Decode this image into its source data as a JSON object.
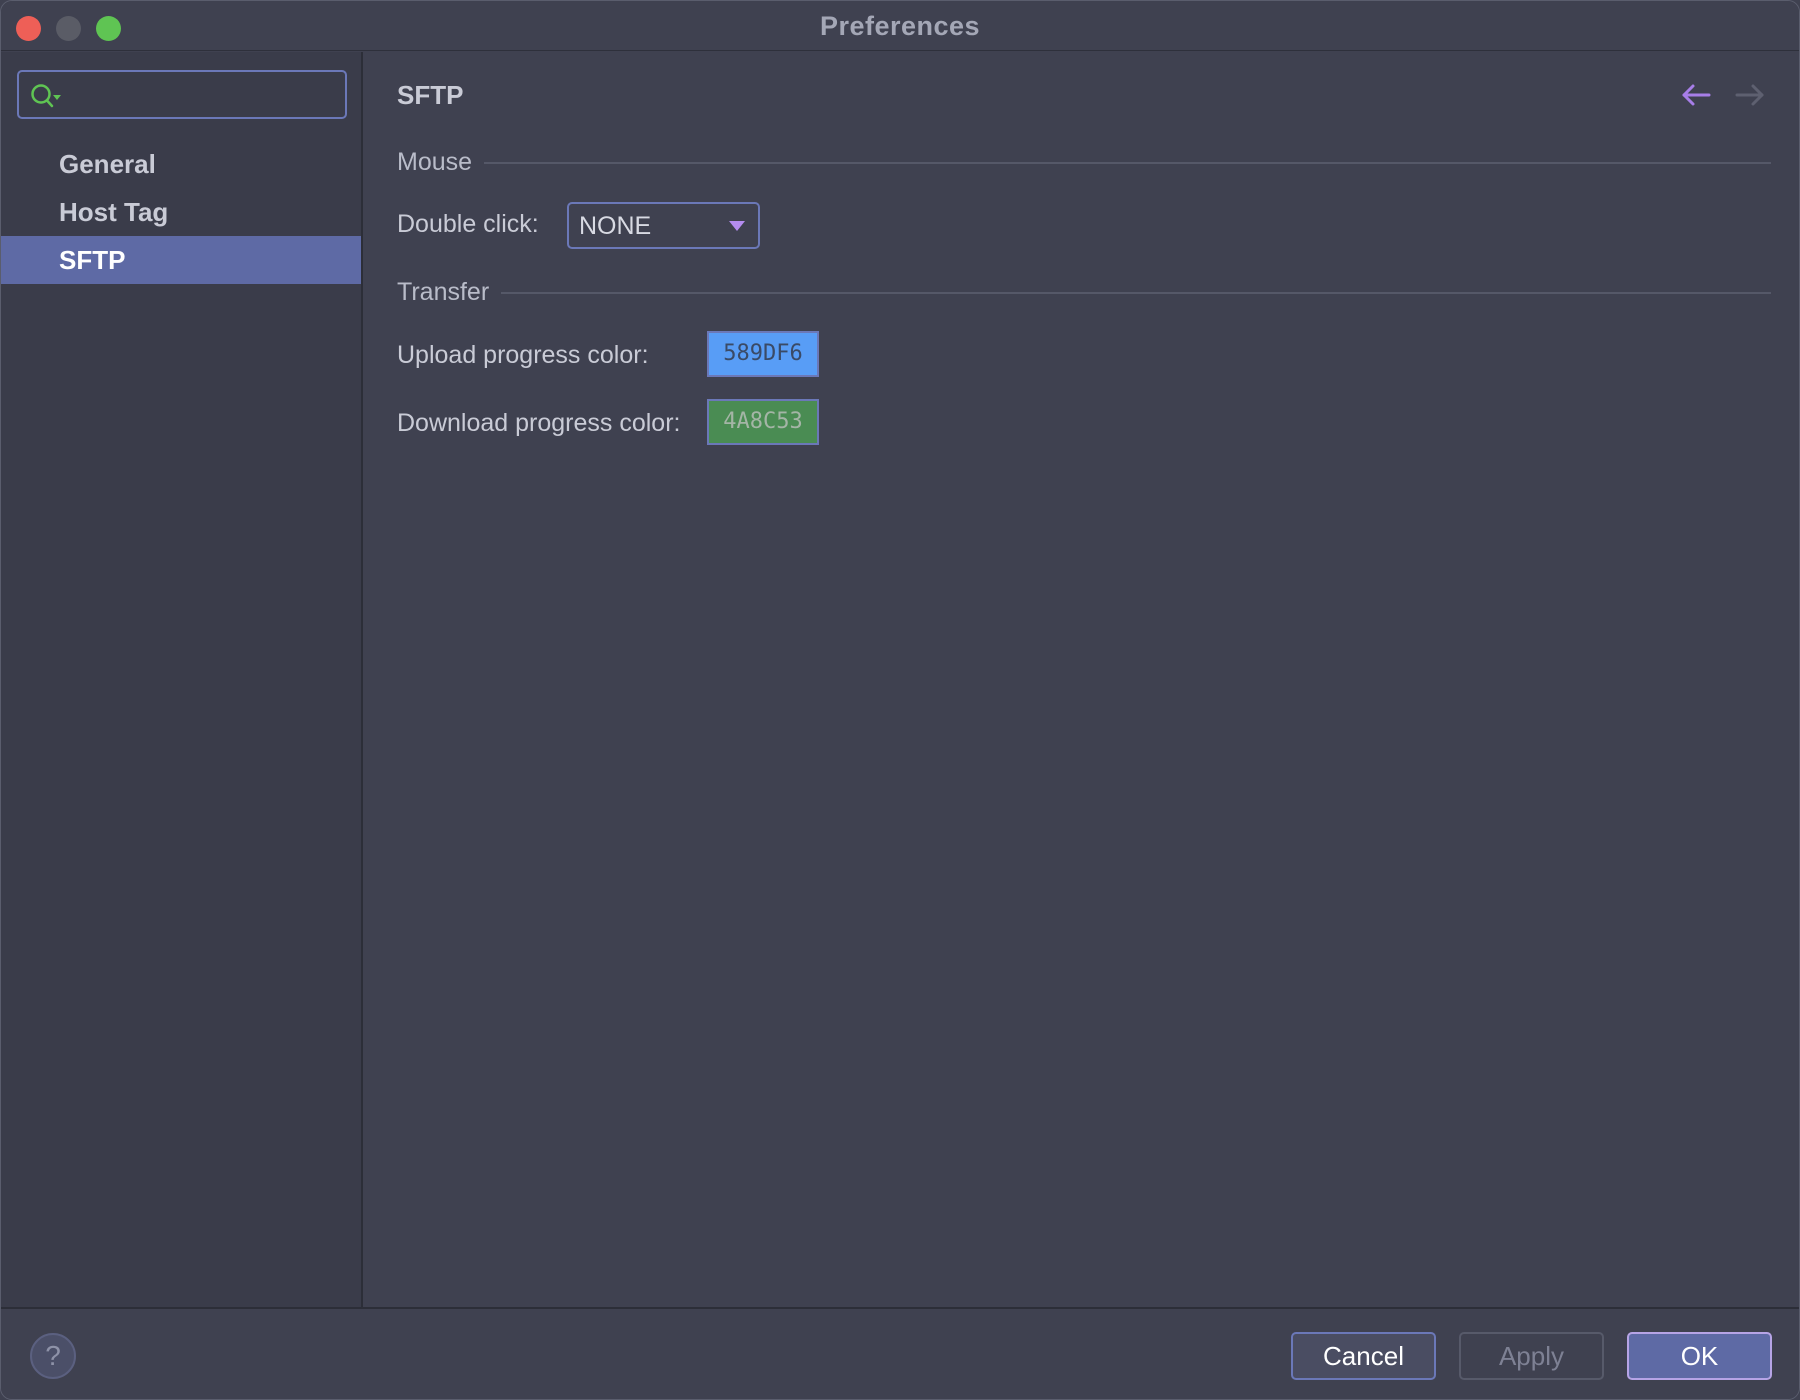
{
  "window": {
    "title": "Preferences"
  },
  "sidebar": {
    "search": {
      "value": "",
      "placeholder": ""
    },
    "items": [
      {
        "label": "General",
        "selected": false
      },
      {
        "label": "Host Tag",
        "selected": false
      },
      {
        "label": "SFTP",
        "selected": true
      }
    ]
  },
  "main": {
    "title": "SFTP",
    "sections": {
      "mouse": {
        "label": "Mouse",
        "double_click_label": "Double click:",
        "double_click_value": "NONE"
      },
      "transfer": {
        "label": "Transfer",
        "upload_label": "Upload progress color:",
        "upload_value": "589DF6",
        "download_label": "Download progress color:",
        "download_value": "4A8C53"
      }
    }
  },
  "footer": {
    "help_label": "?",
    "cancel_label": "Cancel",
    "apply_label": "Apply",
    "ok_label": "OK"
  },
  "colors": {
    "accent": "#6B78B8",
    "selection": "#5E6AA5",
    "upload_swatch": "#589DF6",
    "download_swatch": "#4A8C53",
    "back_arrow": "#A77EE8",
    "forward_arrow": "#5E6070",
    "close": "#EE5F57",
    "minimize": "#5A5C66",
    "maximize": "#5FC453"
  },
  "icons": {
    "search": "search-icon",
    "dropdown": "chevron-down-icon",
    "back": "arrow-left-icon",
    "forward": "arrow-right-icon",
    "help": "question-mark-icon"
  }
}
